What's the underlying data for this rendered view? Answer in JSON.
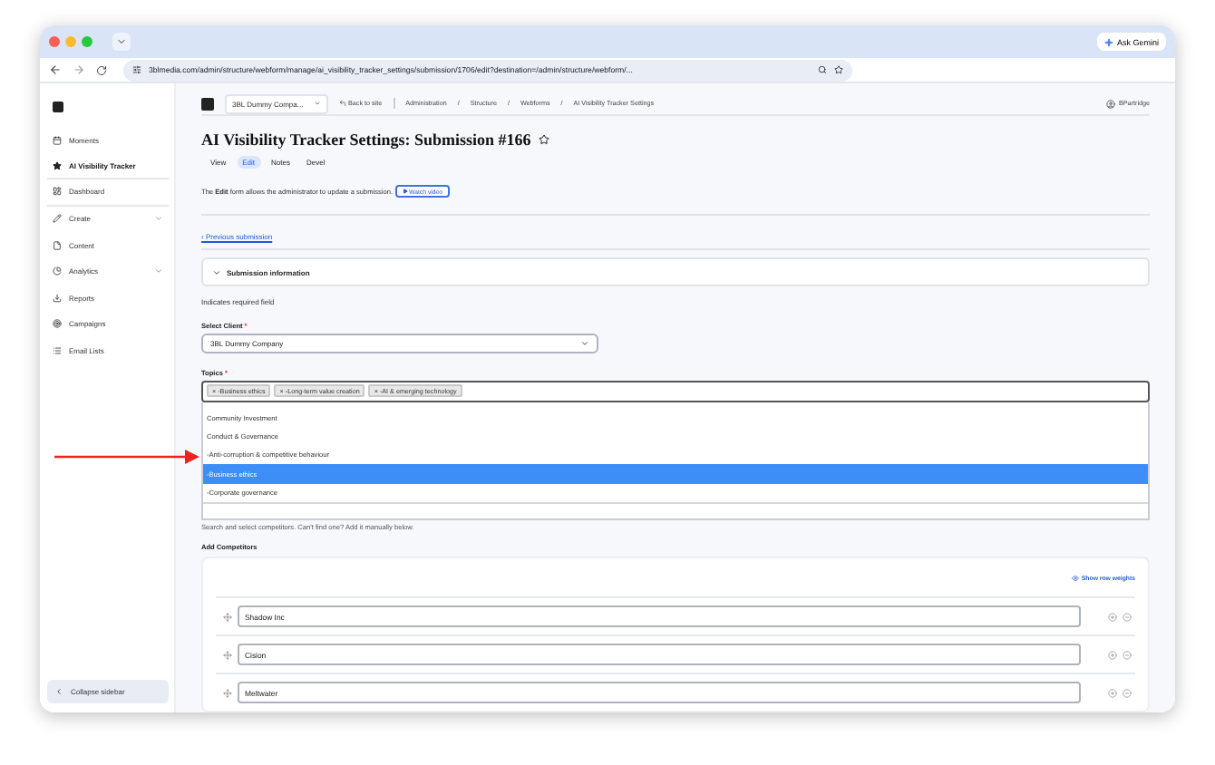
{
  "browser": {
    "gemini_button": "Ask Gemini",
    "url": "3blmedia.com/admin/structure/webform/manage/ai_visibility_tracker_settings/submission/1706/edit?destination=/admin/structure/webform/..."
  },
  "sidebar": {
    "items": [
      {
        "label": "Moments",
        "selected": false,
        "expandable": false,
        "divider_after": false
      },
      {
        "label": "AI Visibility Tracker",
        "selected": true,
        "expandable": false,
        "divider_after": true
      },
      {
        "label": "Dashboard",
        "selected": false,
        "expandable": false,
        "divider_after": true
      },
      {
        "label": "Create",
        "selected": false,
        "expandable": true,
        "divider_after": false
      },
      {
        "label": "Content",
        "selected": false,
        "expandable": false,
        "divider_after": false
      },
      {
        "label": "Analytics",
        "selected": false,
        "expandable": true,
        "divider_after": false
      },
      {
        "label": "Reports",
        "selected": false,
        "expandable": false,
        "divider_after": false
      },
      {
        "label": "Campaigns",
        "selected": false,
        "expandable": false,
        "divider_after": false
      },
      {
        "label": "Email Lists",
        "selected": false,
        "expandable": false,
        "divider_after": false
      }
    ],
    "collapse_button": "Collapse sidebar"
  },
  "header": {
    "company_select": "3BL Dummy Compa...",
    "back_link": "Back to site",
    "breadcrumb": [
      "Administration",
      "Structure",
      "Webforms",
      "AI Visibility Tracker Settings"
    ],
    "breadcrumb_separator": "/",
    "user": "BPartridge"
  },
  "page_title": "AI Visibility Tracker Settings: Submission #166",
  "tabs": [
    {
      "label": "View",
      "selected": false
    },
    {
      "label": "Edit",
      "selected": true
    },
    {
      "label": "Notes",
      "selected": false
    },
    {
      "label": "Devel",
      "selected": false
    }
  ],
  "description": "The **Edit** form allows the administrator to update a submission.",
  "watch_video_button": "Watch video",
  "previous_link": "‹ Previous submission",
  "details": {
    "title": "Submission information",
    "expanded": true
  },
  "required_note": "Indicates required field",
  "client_field": {
    "label": "Select Client",
    "required_mark": "*",
    "value": "3BL Dummy Company"
  },
  "topics_field": {
    "label": "Topics",
    "required_mark": "*",
    "chips": [
      {
        "label": "-Business ethics",
        "remove": "×"
      },
      {
        "label": "-Long-term value creation",
        "remove": "×"
      },
      {
        "label": "-AI & emerging technology",
        "remove": "×"
      }
    ],
    "options": [
      {
        "label": "Community Investment",
        "selected": false
      },
      {
        "label": "Conduct & Governance",
        "selected": false
      },
      {
        "label": "-Anti-corruption & competitive behaviour",
        "selected": false
      },
      {
        "label": "-Business ethics",
        "selected": true
      },
      {
        "label": "-Corporate governance",
        "selected": false
      }
    ]
  },
  "competitors_help": "Search and select competitors. Can't find one? Add it manually below.",
  "competitors": {
    "label": "Add Competitors",
    "show_weights_link": "Show row weights",
    "rows": [
      {
        "value": "Shadow Inc"
      },
      {
        "value": "Cision"
      },
      {
        "value": "Meltwater"
      }
    ]
  }
}
